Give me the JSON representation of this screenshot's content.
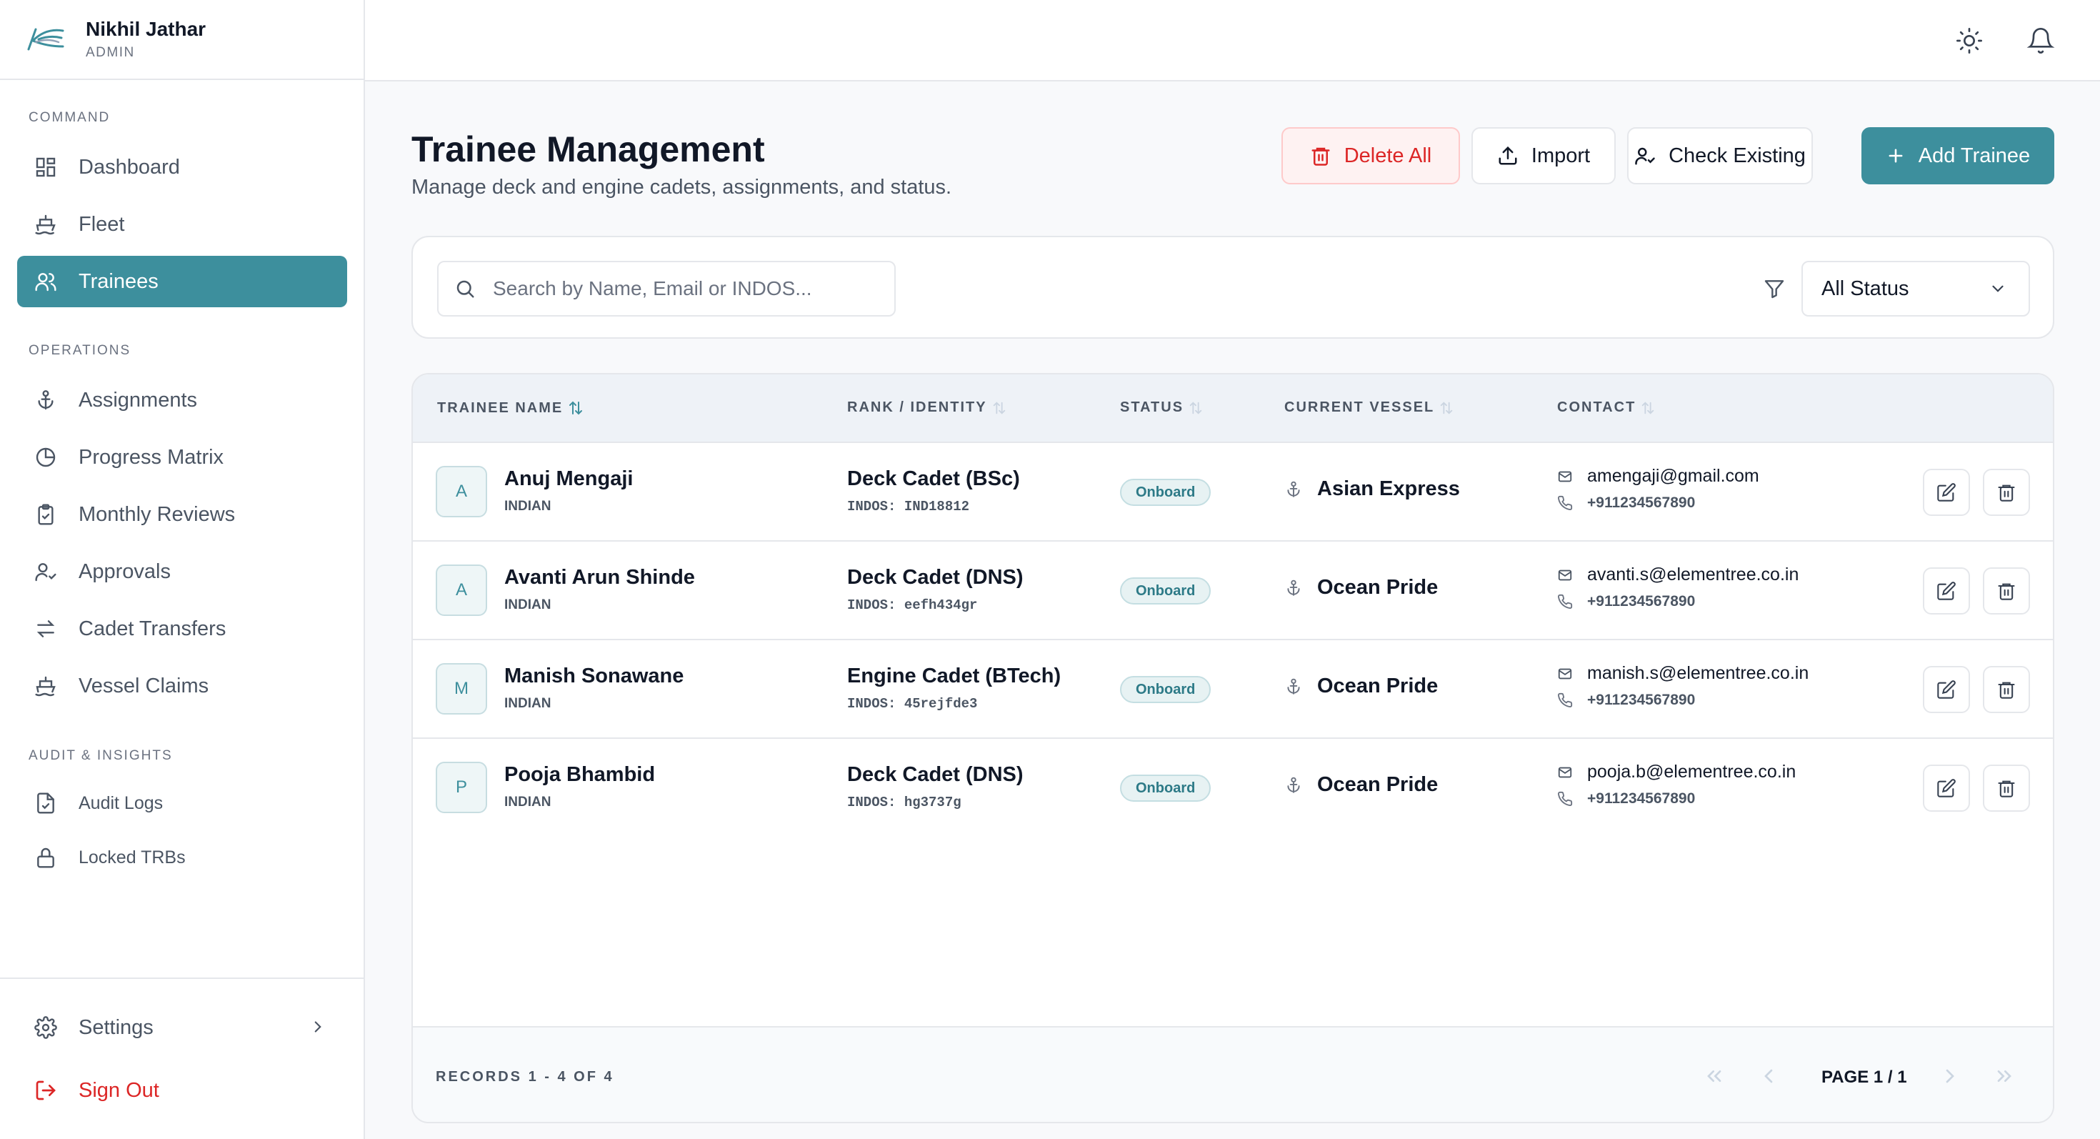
{
  "user": {
    "name": "Nikhil Jathar",
    "role": "ADMIN"
  },
  "sidebar": {
    "sections": [
      {
        "label": "COMMAND"
      },
      {
        "label": "OPERATIONS"
      },
      {
        "label": "AUDIT & INSIGHTS"
      }
    ],
    "items": [
      {
        "label": "Dashboard",
        "icon": "dashboard-icon"
      },
      {
        "label": "Fleet",
        "icon": "ship-icon"
      },
      {
        "label": "Trainees",
        "icon": "users-icon",
        "active": true
      },
      {
        "label": "Assignments",
        "icon": "anchor-icon"
      },
      {
        "label": "Progress Matrix",
        "icon": "pie-chart-icon"
      },
      {
        "label": "Monthly Reviews",
        "icon": "clipboard-check-icon"
      },
      {
        "label": "Approvals",
        "icon": "user-check-icon"
      },
      {
        "label": "Cadet Transfers",
        "icon": "transfer-icon"
      },
      {
        "label": "Vessel Claims",
        "icon": "ship-icon"
      },
      {
        "label": "Audit Logs",
        "icon": "file-check-icon"
      },
      {
        "label": "Locked TRBs",
        "icon": "lock-icon"
      }
    ],
    "settings_label": "Settings",
    "signout_label": "Sign Out"
  },
  "page": {
    "title": "Trainee Management",
    "subtitle": "Manage deck and engine cadets, assignments, and status."
  },
  "actions": {
    "delete_all": "Delete All",
    "import": "Import",
    "check_existing": "Check Existing",
    "add_trainee": "Add Trainee"
  },
  "filters": {
    "search_placeholder": "Search by Name, Email or INDOS...",
    "search_value": "",
    "status_selected": "All Status"
  },
  "table": {
    "columns": [
      "TRAINEE NAME",
      "RANK / IDENTITY",
      "STATUS",
      "CURRENT VESSEL",
      "CONTACT"
    ],
    "rows": [
      {
        "initial": "A",
        "name": "Anuj Mengaji",
        "nationality": "INDIAN",
        "rank": "Deck Cadet (BSc)",
        "indos": "INDOS: IND18812",
        "status": "Onboard",
        "vessel": "Asian Express",
        "email": "amengaji@gmail.com",
        "phone": "+911234567890"
      },
      {
        "initial": "A",
        "name": "Avanti Arun Shinde",
        "nationality": "INDIAN",
        "rank": "Deck Cadet (DNS)",
        "indos": "INDOS: eefh434gr",
        "status": "Onboard",
        "vessel": "Ocean Pride",
        "email": "avanti.s@elementree.co.in",
        "phone": "+911234567890"
      },
      {
        "initial": "M",
        "name": "Manish Sonawane",
        "nationality": "INDIAN",
        "rank": "Engine Cadet (BTech)",
        "indos": "INDOS: 45rejfde3",
        "status": "Onboard",
        "vessel": "Ocean Pride",
        "email": "manish.s@elementree.co.in",
        "phone": "+911234567890"
      },
      {
        "initial": "P",
        "name": "Pooja Bhambid",
        "nationality": "INDIAN",
        "rank": "Deck Cadet (DNS)",
        "indos": "INDOS: hg3737g",
        "status": "Onboard",
        "vessel": "Ocean Pride",
        "email": "pooja.b@elementree.co.in",
        "phone": "+911234567890"
      }
    ],
    "records_label": "RECORDS 1 - 4 OF 4",
    "page_label": "PAGE 1 / 1"
  },
  "colors": {
    "accent": "#3d8f9d",
    "danger": "#dc2626"
  }
}
